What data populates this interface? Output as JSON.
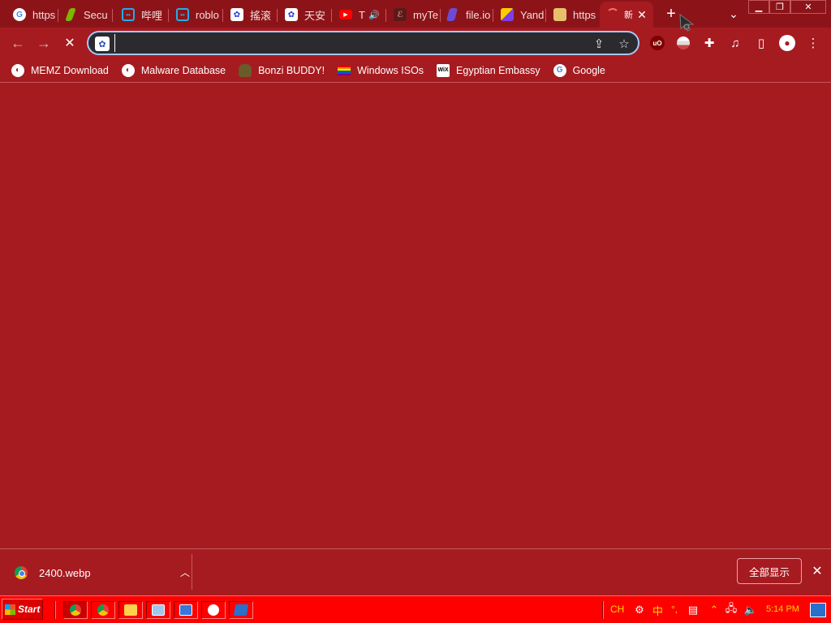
{
  "tabs": [
    {
      "title": "https",
      "favicon": "google-g-icon",
      "color": "#ffffff"
    },
    {
      "title": "Secu",
      "favicon": "security-leaf-icon",
      "color": "#7ab800"
    },
    {
      "title": "哔哩",
      "favicon": "bilibili-icon",
      "color": "#23ade5"
    },
    {
      "title": "roblo",
      "favicon": "bilibili-icon",
      "color": "#23ade5"
    },
    {
      "title": "搖滚",
      "favicon": "baidu-paw-icon",
      "color": "#2932e1"
    },
    {
      "title": "天安",
      "favicon": "baidu-paw-icon",
      "color": "#2932e1"
    },
    {
      "title": "T",
      "favicon": "youtube-icon",
      "color": "#ff0000"
    },
    {
      "title": "myTe",
      "favicon": "mytea-icon",
      "color": "#5a1a1a"
    },
    {
      "title": "file.io",
      "favicon": "file-io-icon",
      "color": "#6b4bd6"
    },
    {
      "title": "Yand",
      "favicon": "yandex-games-icon",
      "color": "#ffcc00"
    },
    {
      "title": "https",
      "favicon": "image-thumbnail-icon",
      "color": "#e8c06b"
    },
    {
      "title": "新",
      "favicon": "loading-spinner-icon",
      "color": "#ff6b6b"
    }
  ],
  "toolbar": {
    "omnibox_value": ""
  },
  "bookmarks": [
    {
      "label": "MEMZ Download",
      "icon": "globe-icon"
    },
    {
      "label": "Malware Database",
      "icon": "globe-icon"
    },
    {
      "label": "Bonzi BUDDY!",
      "icon": "bonzi-icon"
    },
    {
      "label": "Windows ISOs",
      "icon": "rainbow-flag-icon"
    },
    {
      "label": "Egyptian Embassy",
      "icon": "wix-icon"
    },
    {
      "label": "Google",
      "icon": "google-g-icon"
    }
  ],
  "download_shelf": {
    "filename": "2400.webp",
    "show_all_label": "全部显示"
  },
  "taskbar": {
    "start_label": "Start",
    "lang": "CH",
    "ime": "中",
    "punct": "°,",
    "clock": "5:14 PM"
  },
  "colors": {
    "theme": "#a61b20",
    "taskbar": "#ff0000",
    "tray_text": "#ffd400"
  }
}
